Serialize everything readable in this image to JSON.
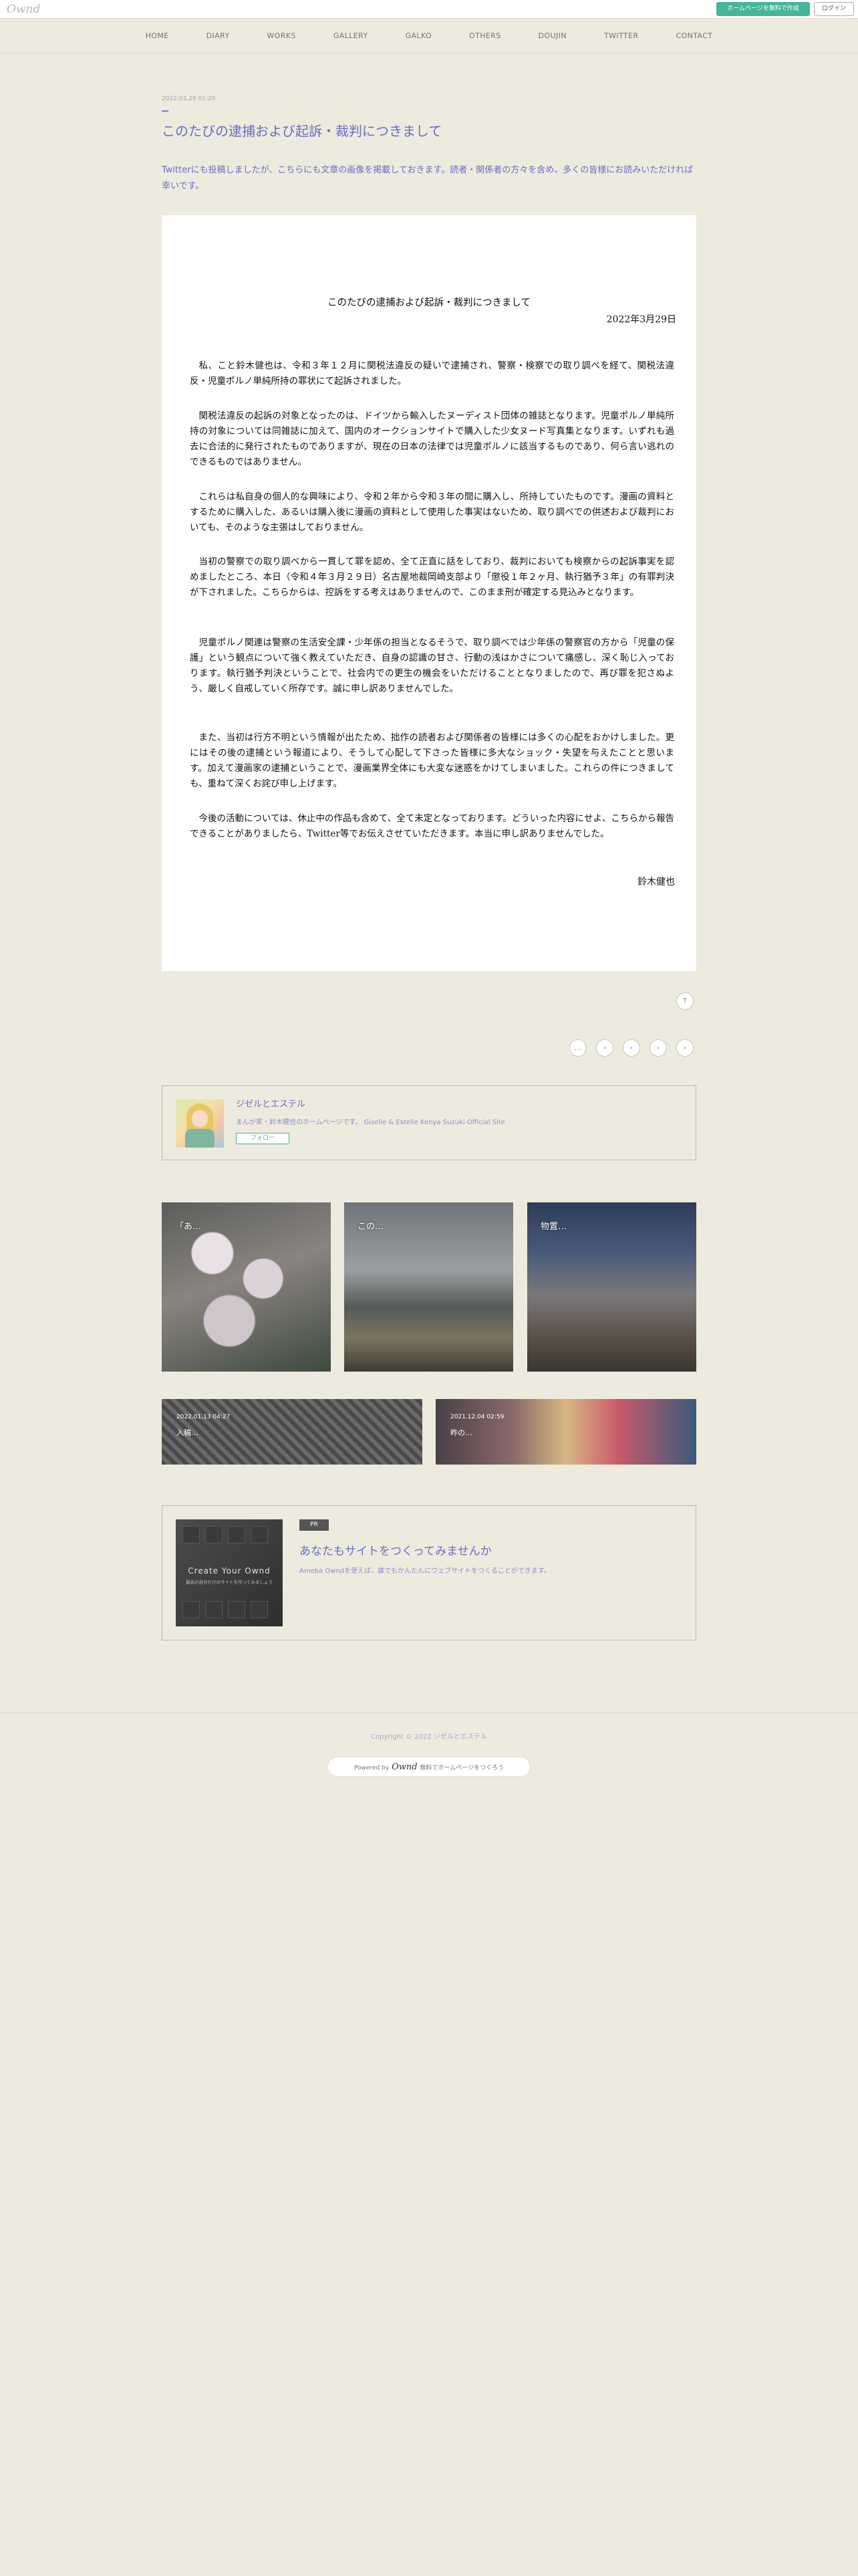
{
  "topbar": {
    "logo": "Ownd",
    "create_button": "ホームページを無料で作成",
    "login_button": "ログイン"
  },
  "nav": {
    "items": [
      "HOME",
      "DIARY",
      "WORKS",
      "GALLERY",
      "GALKO",
      "OTHERS",
      "DOUJIN",
      "TWITTER",
      "CONTACT"
    ]
  },
  "post": {
    "date": "2022.03.29 01:20",
    "title": "このたびの逮捕および起訴・裁判につきまして",
    "lead": "Twitterにも投稿しましたが、こちらにも文章の画像を掲載しておきます。読者・関係者の方々を含め、多くの皆様にお読みいただければ幸いです。"
  },
  "document": {
    "title": "このたびの逮捕および起訴・裁判につきまして",
    "date": "2022年3月29日",
    "paragraphs": [
      "私、こと鈴木健也は、令和３年１２月に関税法違反の疑いで逮捕され、警察・検察での取り調べを経て、関税法違反・児童ポルノ単純所持の罪状にて起訴されました。",
      "関税法違反の起訴の対象となったのは、ドイツから輸入したヌーディスト団体の雑誌となります。児童ポルノ単純所持の対象については同雑誌に加えて、国内のオークションサイトで購入した少女ヌード写真集となります。いずれも過去に合法的に発行されたものでありますが、現在の日本の法律では児童ポルノに該当するものであり、何ら言い逃れのできるものではありません。",
      "これらは私自身の個人的な興味により、令和２年から令和３年の間に購入し、所持していたものです。漫画の資料とするために購入した、あるいは購入後に漫画の資料として使用した事実はないため、取り調べでの供述および裁判においても、そのような主張はしておりません。",
      "当初の警察での取り調べから一貫して罪を認め、全て正直に話をしており、裁判においても検察からの起訴事実を認めましたところ、本日（令和４年３月２９日）名古屋地裁岡崎支部より「懲役１年２ヶ月、執行猶予３年」の有罪判決が下されました。こちらからは、控訴をする考えはありませんので、このまま刑が確定する見込みとなります。",
      "児童ポルノ関連は警察の生活安全課・少年係の担当となるそうで、取り調べでは少年係の警察官の方から「児童の保護」という観点について強く教えていただき、自身の認識の甘さ、行動の浅はかさについて痛感し、深く恥じ入っております。執行猶予判決ということで、社会内での更生の機会をいただけることとなりましたので、再び罪を犯さぬよう、厳しく自戒していく所存です。誠に申し訳ありませんでした。",
      "また、当初は行方不明という情報が出たため、拙作の読者および関係者の皆様には多くの心配をおかけしました。更にはその後の逮捕という報道により、そうして心配して下さった皆様に多大なショック・失望を与えたことと思います。加えて漫画家の逮捕ということで、漫画業界全体にも大変な迷惑をかけてしまいました。これらの件につきましても、重ねて深くお詫び申し上げます。",
      "今後の活動については、休止中の作品も含めて、全て未定となっております。どういった内容にせよ、こちらから報告できることがありましたら、Twitter等でお伝えさせていただきます。本当に申し訳ありませんでした。"
    ],
    "signature": "鈴木健也"
  },
  "pager": {
    "up": "↑",
    "items": [
      "…",
      "‹",
      "‹",
      "‹",
      "›"
    ]
  },
  "profile": {
    "name": "ジゼルとエステル",
    "desc": "まんが家・鈴木健也のホームページです。 Giselle & Estelle Kenya Suzuki Official Site",
    "follow": "フォロー"
  },
  "tiles": [
    {
      "caption": "「あ…"
    },
    {
      "caption": "この…"
    },
    {
      "caption": "物置…"
    }
  ],
  "wide_tiles": [
    {
      "date": "2022.01.13 04:27",
      "caption": "入稿…"
    },
    {
      "date": "2021.12.04 02:59",
      "caption": "昨の…"
    }
  ],
  "pr": {
    "badge": "PR",
    "title": "あなたもサイトをつくってみませんか",
    "desc": "Ameba Owndを使えば、誰でもかんたんにウェブサイトをつくることができます。",
    "thumb_text": "Create Your Ownd",
    "thumb_sub": "最高の自分だけのサイトを作ってみましょう"
  },
  "footer": {
    "copyright": "Copyright © 2022 ジゼルとエステル",
    "powered_prefix": "Powered by",
    "powered_brand": "Ownd",
    "powered_suffix": "無料でホームページをつくろう"
  }
}
